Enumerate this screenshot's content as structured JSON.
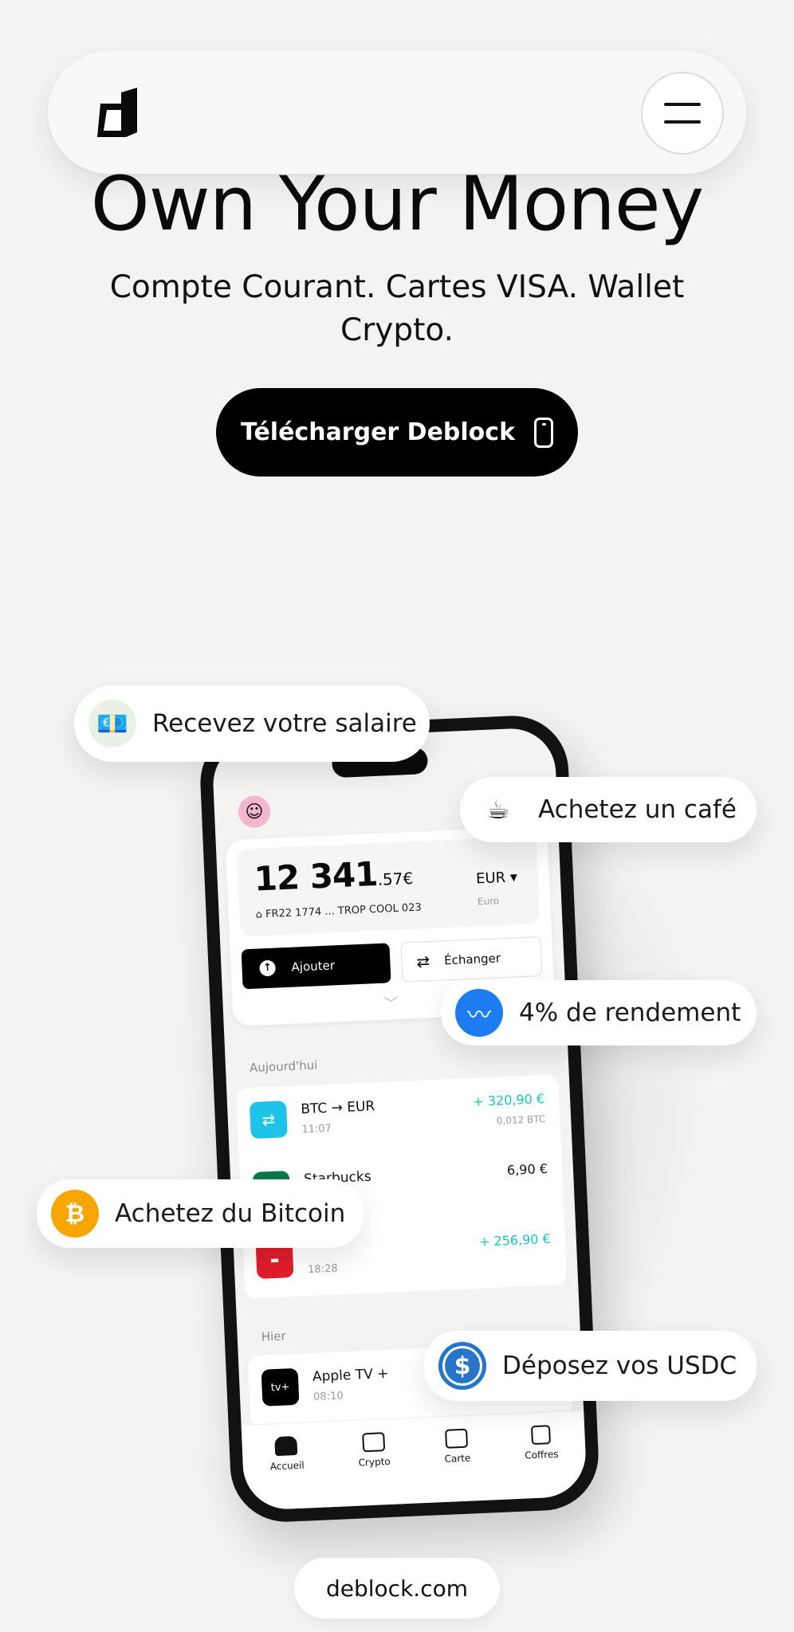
{
  "nav": {
    "menu_aria": "Menu"
  },
  "hero": {
    "title": "Own Your Money",
    "subtitle": "Compte Courant. Cartes VISA. Wallet Crypto.",
    "cta_label": "Télécharger Deblock"
  },
  "phone": {
    "balance": {
      "main": "12 341",
      "cents": ".57€",
      "iban": "FR22 1774 ... TROP COOL 023",
      "currency": "EUR",
      "currency_sub": "Euro"
    },
    "actions": {
      "add": "Ajouter",
      "swap": "Échanger"
    },
    "today_label": "Aujourd'hui",
    "yesterday_label": "Hier",
    "transactions_today": [
      {
        "name": "BTC → EUR",
        "time": "11:07",
        "amount": "+ 320,90 €",
        "sub": "0,012 BTC",
        "positive": true
      },
      {
        "name": "Starbucks",
        "time": "",
        "amount": "6,90 €",
        "sub": "",
        "positive": false
      },
      {
        "name": "",
        "time": "18:28",
        "amount": "+ 256,90 €",
        "sub": "",
        "positive": true
      }
    ],
    "transactions_yesterday": [
      {
        "name": "Apple TV +",
        "time": "08:10"
      }
    ],
    "bottom_nav": [
      "Accueil",
      "Crypto",
      "Carte",
      "Coffres"
    ]
  },
  "pills": {
    "salary": "Recevez votre salaire",
    "coffee": "Achetez un café",
    "yield": "4% de rendement",
    "btc": "Achetez du Bitcoin",
    "usdc": "Déposez vos USDC"
  },
  "footer": {
    "url": "deblock.com"
  },
  "colors": {
    "accent_teal": "#19c7b4",
    "btc_orange": "#f7a600",
    "usdc_blue": "#2775ca",
    "yield_blue": "#1d7cf2"
  }
}
